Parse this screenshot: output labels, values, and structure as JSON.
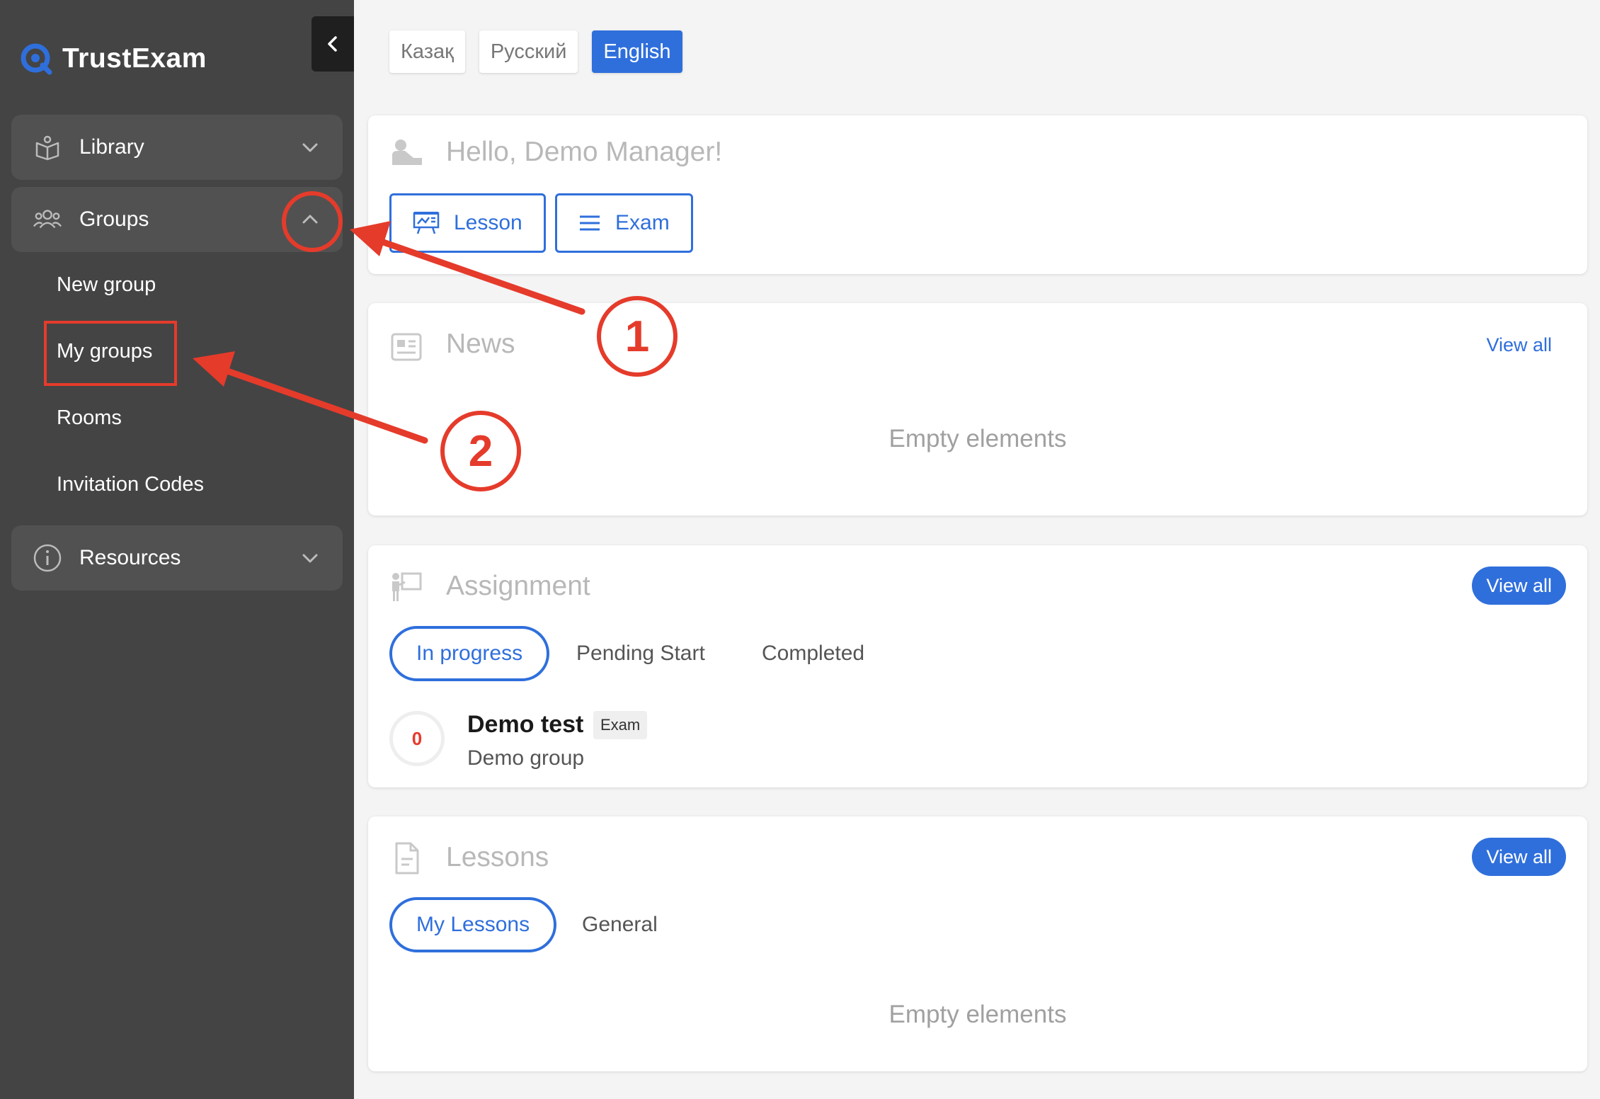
{
  "app": {
    "name": "TrustExam"
  },
  "sidebar": {
    "items": [
      {
        "label": "Library",
        "icon": "book-open-icon"
      },
      {
        "label": "Groups",
        "icon": "users-icon"
      },
      {
        "label": "Resources",
        "icon": "info-icon"
      }
    ],
    "group_sub_items": [
      "New group",
      "My groups",
      "Rooms",
      "Invitation Codes"
    ]
  },
  "languages": [
    {
      "label": "Казақ",
      "active": false
    },
    {
      "label": "Русский",
      "active": false
    },
    {
      "label": "English",
      "active": true
    }
  ],
  "greeting": {
    "text": "Hello, Demo Manager!",
    "buttons": [
      {
        "label": "Lesson",
        "icon": "presentation-icon"
      },
      {
        "label": "Exam",
        "icon": "list-icon"
      }
    ]
  },
  "news": {
    "title": "News",
    "view_all": "View all",
    "empty": "Empty elements"
  },
  "assignment": {
    "title": "Assignment",
    "view_all": "View all",
    "tabs": [
      "In progress",
      "Pending Start",
      "Completed"
    ],
    "active_tab": "In progress",
    "items": [
      {
        "score": "0",
        "title": "Demo test",
        "badge": "Exam",
        "group": "Demo group"
      }
    ]
  },
  "lessons": {
    "title": "Lessons",
    "view_all": "View all",
    "tabs": [
      "My Lessons",
      "General"
    ],
    "active_tab": "My Lessons",
    "empty": "Empty elements"
  },
  "annotations": {
    "step1": "1",
    "step2": "2"
  },
  "colors": {
    "accent": "#2f6fdc",
    "sidebar": "#444444",
    "annotation": "#e53b2b"
  }
}
